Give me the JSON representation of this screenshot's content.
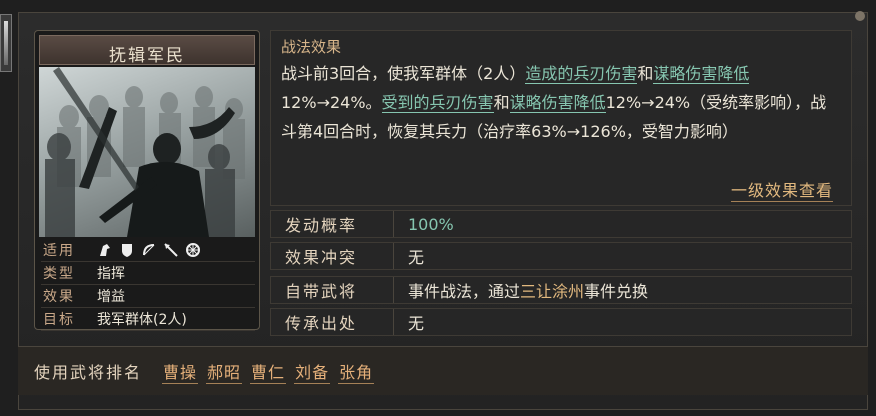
{
  "card": {
    "title": "抚辑军民",
    "info": [
      {
        "key": "适用",
        "value": "",
        "icons": [
          "horse-head-icon",
          "shield-icon",
          "bow-icon",
          "spear-icon",
          "wheel-icon"
        ]
      },
      {
        "key": "类型",
        "value": "指挥"
      },
      {
        "key": "效果",
        "value": "增益"
      },
      {
        "key": "目标",
        "value": "我军群体(2人)"
      }
    ]
  },
  "effect": {
    "heading": "战法效果",
    "segments": {
      "s1": "战斗前3回合，使我军群体（2人）",
      "h1": "造成的兵刃伤害",
      "s2": "和",
      "h2": "谋略伤害降低",
      "s3": "12%→24%。",
      "h3": "受到的兵刃伤害",
      "s4": "和",
      "h4": "谋略伤害降低",
      "s5": "12%→24%（受统率影响），战斗第4回合时，恢复其兵力（治疗率63%→126%，受智力影响）"
    },
    "level_link": "一级效果查看"
  },
  "stats": {
    "probability": {
      "key": "发动概率",
      "value": "100%"
    },
    "conflict": {
      "key": "效果冲突",
      "value": "无"
    },
    "general": {
      "key": "自带武将",
      "prefix": "事件战法，通过",
      "link": "三让涂州",
      "suffix": "事件兑换"
    },
    "inherit": {
      "key": "传承出处",
      "value": "无"
    }
  },
  "bottom": {
    "label": "使用武将排名",
    "generals": [
      "曹操",
      "郝昭",
      "曹仁",
      "刘备",
      "张角"
    ]
  },
  "colors": {
    "accent_teal": "#86c6b0",
    "accent_gold": "#e2b97f",
    "label_tan": "#c9a889"
  }
}
